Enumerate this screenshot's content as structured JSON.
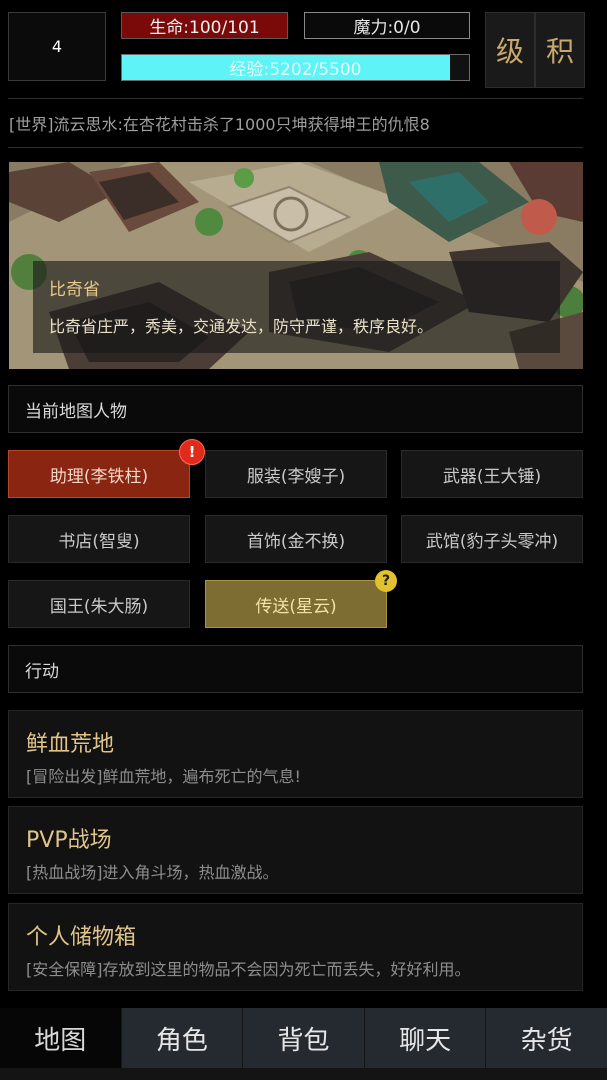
{
  "player": {
    "level": "4",
    "hp_text": "生命:100/101",
    "mp_text": "魔力:0/0",
    "exp_text": "经验:5202/5500",
    "exp_current": 5202,
    "exp_max": 5500
  },
  "side_buttons": {
    "level": "级",
    "points": "积"
  },
  "world_message": "[世界]流云思水:在杏花村击杀了1000只坤获得坤王的仇恨8",
  "map": {
    "name": "比奇省",
    "description": "比奇省庄严，秀美，交通发达，防守严谨，秩序良好。"
  },
  "npc_section_title": "当前地图人物",
  "npcs": [
    {
      "label": "助理(李铁柱)"
    },
    {
      "label": "服装(李嫂子)"
    },
    {
      "label": "武器(王大锤)"
    },
    {
      "label": "书店(智叟)"
    },
    {
      "label": "首饰(金不换)"
    },
    {
      "label": "武馆(豹子头零冲)"
    },
    {
      "label": "国王(朱大肠)"
    },
    {
      "label": "传送(星云)"
    }
  ],
  "badges": {
    "alert": "!",
    "quest": "?"
  },
  "action_section_title": "行动",
  "actions": [
    {
      "title": "鲜血荒地",
      "desc": "[冒险出发]鲜血荒地，遍布死亡的气息!"
    },
    {
      "title": "PVP战场",
      "desc": "[热血战场]进入角斗场，热血激战。"
    },
    {
      "title": "个人储物箱",
      "desc": "[安全保障]存放到这里的物品不会因为死亡而丢失，好好利用。"
    }
  ],
  "tabs": [
    {
      "label": "地图"
    },
    {
      "label": "角色"
    },
    {
      "label": "背包"
    },
    {
      "label": "聊天"
    },
    {
      "label": "杂货"
    }
  ],
  "colors": {
    "hp": "#7a0a0a",
    "exp": "#5ef3f7",
    "active_npc": "#8a2512",
    "quest_npc": "#7d6d32",
    "gold_text": "#e0c48a"
  }
}
